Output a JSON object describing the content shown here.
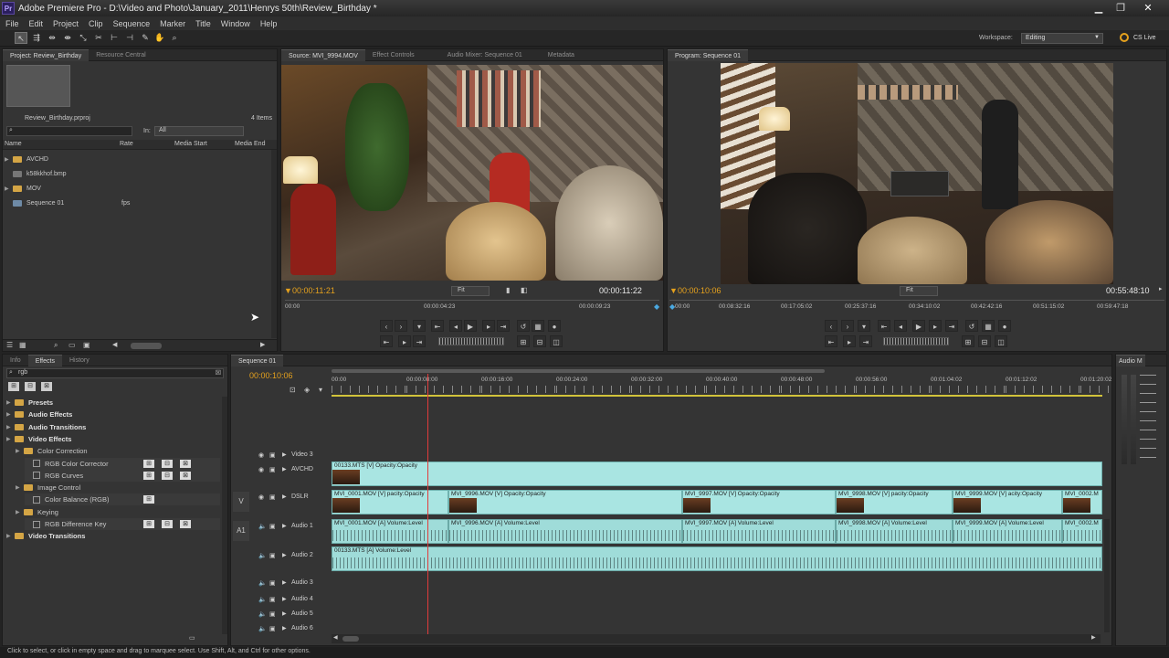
{
  "window": {
    "title": "Adobe Premiere Pro - D:\\Video and Photo\\January_2011\\Henrys 50th\\Review_Birthday *",
    "logo": "Pr"
  },
  "menu": [
    "File",
    "Edit",
    "Project",
    "Clip",
    "Sequence",
    "Marker",
    "Title",
    "Window",
    "Help"
  ],
  "toolbar": {
    "workspace_label": "Workspace:",
    "workspace_value": "Editing",
    "cs_live": "CS Live"
  },
  "project": {
    "tabs": [
      "Project: Review_Birthday",
      "Resource Central"
    ],
    "filename": "Review_Birthday.prproj",
    "count": "4 Items",
    "in_label": "In:",
    "in_value": "All",
    "columns": [
      "Name",
      "Rate",
      "Media Start",
      "Media End"
    ],
    "items": [
      {
        "name": "AVCHD",
        "rate": ""
      },
      {
        "name": "k58kkhof.bmp",
        "rate": ""
      },
      {
        "name": "MOV",
        "rate": ""
      },
      {
        "name": "Sequence 01",
        "rate": "fps"
      }
    ]
  },
  "source": {
    "tabs": [
      "Source: MVI_9994.MOV",
      "Effect Controls",
      "Audio Mixer: Sequence 01",
      "Metadata"
    ],
    "tc_current": "00:00:11:21",
    "tc_duration": "00:00:11:22",
    "fit": "Fit",
    "ruler": [
      "00:00",
      "00:00:04:23",
      "00:00:09:23"
    ]
  },
  "program": {
    "tabs": [
      "Program: Sequence 01"
    ],
    "tc_current": "00:00:10:06",
    "tc_duration": "00:55:48:10",
    "fit": "Fit",
    "ruler": [
      "00:00",
      "00:08:32:16",
      "00:17:05:02",
      "00:25:37:16",
      "00:34:10:02",
      "00:42:42:16",
      "00:51:15:02",
      "00:59:47:18"
    ]
  },
  "effects": {
    "tabs": [
      "Info",
      "Effects",
      "History"
    ],
    "search": "rgb",
    "tree": [
      {
        "label": "Presets",
        "level": 0
      },
      {
        "label": "Audio Effects",
        "level": 0
      },
      {
        "label": "Audio Transitions",
        "level": 0
      },
      {
        "label": "Video Effects",
        "level": 0
      },
      {
        "label": "Color Correction",
        "level": 1
      },
      {
        "label": "RGB Color Corrector",
        "level": 2
      },
      {
        "label": "RGB Curves",
        "level": 2
      },
      {
        "label": "Image Control",
        "level": 1
      },
      {
        "label": "Color Balance (RGB)",
        "level": 2
      },
      {
        "label": "Keying",
        "level": 1
      },
      {
        "label": "RGB Difference Key",
        "level": 2
      },
      {
        "label": "Video Transitions",
        "level": 0
      }
    ]
  },
  "timeline": {
    "tab": "Sequence 01",
    "timecode": "00:00:10:06",
    "ruler": [
      "00:00",
      "00:00:08:00",
      "00:00:16:00",
      "00:00:24:00",
      "00:00:32:00",
      "00:00:40:00",
      "00:00:48:00",
      "00:00:56:00",
      "00:01:04:02",
      "00:01:12:02",
      "00:01:20:02"
    ],
    "tracks": [
      "Video 3",
      "AVCHD",
      "DSLR",
      "Audio 1",
      "Audio 2",
      "Audio 3",
      "Audio 4",
      "Audio 5",
      "Audio 6"
    ],
    "labels": {
      "v": "V",
      "a": "A1"
    },
    "clips": {
      "avchd": "00133.MTS [V] Opacity:Opacity",
      "dslr": [
        "MVI_0001.MOV [V] pacity:Opacity",
        "MVI_9996.MOV [V] Opacity:Opacity",
        "MVI_9997.MOV [V] Opacity:Opacity",
        "MVI_9998.MOV [V] pacity:Opacity",
        "MVI_9999.MOV [V] acity:Opacity",
        "MVI_0002.M"
      ],
      "audio1": [
        "MVI_0001.MOV [A] Volume:Level",
        "MVI_9996.MOV [A] Volume:Level",
        "MVI_9997.MOV [A] Volume:Level",
        "MVI_9998.MOV [A] Volume:Level",
        "MVI_9999.MOV [A] Volume:Level",
        "MVI_0002.M"
      ],
      "audio2": "00133.MTS [A] Volume:Level"
    }
  },
  "audio_meter": {
    "tab": "Audio M"
  },
  "status": "Click to select, or click in empty space and drag to marquee select. Use Shift, Alt, and Ctrl for other options.",
  "colors": {
    "accent_timecode": "#e5a11d",
    "playhead": "#e23b3b",
    "clip": "#a9e5e2"
  }
}
